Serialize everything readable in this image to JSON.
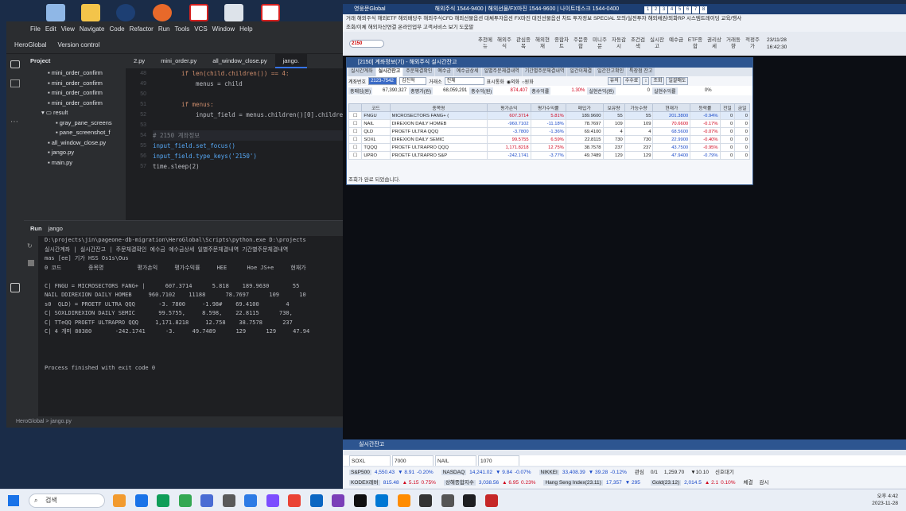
{
  "ide": {
    "menu": [
      "File",
      "Edit",
      "View",
      "Navigate",
      "Code",
      "Refactor",
      "Run",
      "Tools",
      "VCS",
      "Window",
      "Help"
    ],
    "project_name": "HeroGlobal",
    "vcs": "Version control",
    "project_label": "Project",
    "tree": [
      "mini_order_confirm",
      "mini_order_confirm",
      "mini_order_confirm",
      "mini_order_confirm",
      "result",
      "gray_pane_screens",
      "pane_screenshot_f",
      "all_window_close.py",
      "jango.py",
      "main.py"
    ],
    "tabs": [
      "2.py",
      "mini_order.py",
      "all_window_close.py",
      "jango."
    ],
    "gutter": [
      "48",
      "49",
      "50",
      "51",
      "52",
      "53",
      "54",
      "55",
      "56",
      "57",
      "58",
      "59",
      "60",
      "61",
      "62"
    ],
    "code": [
      "if len(child.children()) == 4:",
      "    menus = child",
      "",
      "if menus:",
      "    input_field = menus.children()[0].children()[0]",
      "",
      "# 2150 계좌정보",
      "input_field.set_focus()",
      "input_field.type_keys('2150')",
      "time.sleep(2)"
    ],
    "run_label": "Run",
    "run_config": "jango",
    "console": [
      "D:\\projects\\jin\\pageone-db-migration\\HeroGlobal\\Scripts\\python.exe D:\\projects",
      "실시간계좌 | 실시간잔고 | 주문체결확인 예수금 예수금상세 일별주문체결내역 기간별주문체결내역",
      "mas [ее] 기가 HSS Os1s\\Ous",
      "0 코드        종목명          평가손익     평가수익률     HEE      Hoe JS+e     현재가",
      "",
      "C| FNGU = MICROSECTORS FANG+ |      607.3714      5.818    189.9630       55",
      "NAIL DDIREXION DAILY HOMEB     960.7102    11188      78.7697      109      10",
      "s0  QLD) = PROETF ULTRA QQQ       -3. 7800     -1.98#    69.4100        4",
      "C| SOXLDIREXION DAILY SEMIC       99.5755,     8.598,    22.8115      730,",
      "C| TTeQQ PROETF ULTRAPRO QQQ     1,171.8218     12.758    38.7578      237",
      "C| 4 개미 80380       -242.1741      -3.     49.7489      129      129     47.94",
      "",
      "",
      "",
      "Process finished with exit code 0"
    ],
    "status": "HeroGlobal > jango.py"
  },
  "hts": {
    "title": "영웅문Global",
    "title_info": "해외주식 1544-9400 | 해외선물/FX마진 1544-9600 | 나이트데스크 1544-0400",
    "menu1": "거래  해외주식  해외ETF  해외배당주  해외주식CFD  해외선물옵션  대체투자옵션  FX마진  대진선물옵션  차트  투자정보  SPECIAL  모의/실전투자  해외채권/외화RP  시스템트레이딩  교육/행사",
    "menu2": "조회/이체  해외자산연결  온라인업무  고객서비스  보기  도움말",
    "screen_no": "2150",
    "tool_buttons": [
      "추천메뉴",
      "해외주식",
      "관심종목",
      "해외현재",
      "종합차트",
      "주문종합",
      "미니주문",
      "자동감시",
      "조건검색",
      "실시잔고",
      "예수금",
      "ETF종합",
      "권리상세",
      "거래동향",
      "적정주가"
    ],
    "date": "23/11/28",
    "time": "16:42:30",
    "tabs_numbers": [
      "1",
      "2",
      "3",
      "4",
      "5",
      "6",
      "7",
      "8"
    ]
  },
  "window": {
    "title": "[2150] 계좌정보(기) - 해외주식 실시간잔고",
    "tabs": [
      "실시간계좌",
      "실시간잔고",
      "주문체결확인",
      "예수금",
      "예수금상세",
      "일별주문체결내역",
      "기간별주문체결내역",
      "일간이체결",
      "일간잔고확인",
      "특장점 잔고"
    ],
    "account_label": "계좌번호",
    "account": "2123-7542",
    "owner": "김진혁",
    "exchange_label": "거래소",
    "exchange": "전체",
    "show_label": "표시통화",
    "radio1": "외화",
    "radio2": "원화",
    "buttons": [
      "유의",
      "수수료",
      "↕",
      "조회",
      "일괄매도"
    ],
    "sum_row": [
      {
        "label": "총매입(원)",
        "value": "67,390,327"
      },
      {
        "label": "총평가(원)",
        "value": "68,059,291"
      },
      {
        "label": "총수익(원)",
        "value": "874,407"
      },
      {
        "label": "총수익률",
        "value": "1.30%"
      },
      {
        "label": "실현손익(원)",
        "value": "0"
      },
      {
        "label": "실현수익률",
        "value": "0%"
      }
    ],
    "columns": [
      "",
      "코드",
      "종목명",
      "평가손익",
      "평가수익률",
      "매입가",
      "보유량",
      "가능수량",
      "현재가",
      "등락률",
      "전일",
      "금일"
    ],
    "rows": [
      {
        "code": "FNGU",
        "name": "MICROSECTORS FANG+ (",
        "pl": "607.3714",
        "rate": "5.81%",
        "buy": "189.9600",
        "hold": "55",
        "avail": "55",
        "cur": "201.3800",
        "chg": "-0.94%",
        "prev": "0",
        "today": "0",
        "pl_c": "red",
        "rate_c": "red",
        "cur_c": "blue",
        "chg_c": "blue"
      },
      {
        "code": "NAIL",
        "name": "DIREXION DAILY HOMEB",
        "pl": "-960.7102",
        "rate": "-11.18%",
        "buy": "78.7697",
        "hold": "109",
        "avail": "109",
        "cur": "70.6600",
        "chg": "-0.17%",
        "prev": "0",
        "today": "0",
        "pl_c": "blue",
        "rate_c": "blue",
        "cur_c": "red",
        "chg_c": "red"
      },
      {
        "code": "QLD",
        "name": "PROETF ULTRA QQQ",
        "pl": "-3.7800",
        "rate": "-1.36%",
        "buy": "69.4100",
        "hold": "4",
        "avail": "4",
        "cur": "68.5600",
        "chg": "-0.07%",
        "prev": "0",
        "today": "0",
        "pl_c": "blue",
        "rate_c": "blue",
        "cur_c": "blue",
        "chg_c": "red"
      },
      {
        "code": "SOXL",
        "name": "DIREXION DAILY SEMIC",
        "pl": "99.5755",
        "rate": "6.59%",
        "buy": "22.8115",
        "hold": "730",
        "avail": "730",
        "cur": "22.9900",
        "chg": "-0.40%",
        "prev": "0",
        "today": "0",
        "pl_c": "red",
        "rate_c": "red",
        "cur_c": "blue",
        "chg_c": "red"
      },
      {
        "code": "TQQQ",
        "name": "PROETF ULTRAPRO QQQ",
        "pl": "1,171.8218",
        "rate": "12.75%",
        "buy": "38.7578",
        "hold": "237",
        "avail": "237",
        "cur": "43.7500",
        "chg": "-0.95%",
        "prev": "0",
        "today": "0",
        "pl_c": "red",
        "rate_c": "red",
        "cur_c": "blue",
        "chg_c": "red"
      },
      {
        "code": "UPRO",
        "name": "PROETF ULTRAPRO S&P",
        "pl": "-242.1741",
        "rate": "-3.77%",
        "buy": "49.7489",
        "hold": "129",
        "avail": "129",
        "cur": "47.9400",
        "chg": "-0.79%",
        "prev": "0",
        "today": "0",
        "pl_c": "blue",
        "rate_c": "blue",
        "cur_c": "blue",
        "chg_c": "blue"
      }
    ],
    "status": "조회가 완료 되었습니다."
  },
  "bottom": {
    "title": "실시간잔고",
    "watch": [
      "SOXL",
      "7000",
      "NAIL",
      "1070"
    ],
    "ticker1": [
      {
        "name": "S&P500",
        "val": "4,550.43",
        "chg": "▼ 8.91",
        "pct": "-0.20%"
      },
      {
        "name": "NASDAQ",
        "val": "14,241.02",
        "chg": "▼ 9.84",
        "pct": "-0.07%"
      },
      {
        "name": "NIKKEI",
        "val": "33,408.39",
        "chg": "▼ 39.28",
        "pct": "-0.12%"
      }
    ],
    "ticker1_extra": [
      "관심",
      "0/1",
      "1,259.70",
      "▼10.10",
      "신호대기"
    ],
    "ticker2": [
      {
        "name": "KODEX레버",
        "val": "815.48",
        "chg": "▲ 5.15",
        "pct": "0.75%"
      },
      {
        "name": "상해종합지수",
        "val": "3,038.56",
        "chg": "▲ 6.95",
        "pct": "0.23%"
      },
      {
        "name": "Hang Seng Index(23.11)",
        "val": "17,357",
        "chg": "▼ 295",
        "pct": ""
      },
      {
        "name": "Gold(23.12)",
        "val": "2,014.5",
        "chg": "▲ 2.1",
        "pct": "0.10%"
      }
    ],
    "ticker2_extra": [
      "체결",
      "감시"
    ]
  },
  "taskbar": {
    "search": "검색",
    "time_ampm": "오후 4:42",
    "date": "2023-11-28"
  },
  "colors": {
    "ide_bg": "#1e1f22",
    "hts_title": "#1d3f73",
    "red": "#d0021b",
    "blue": "#1747c8"
  }
}
